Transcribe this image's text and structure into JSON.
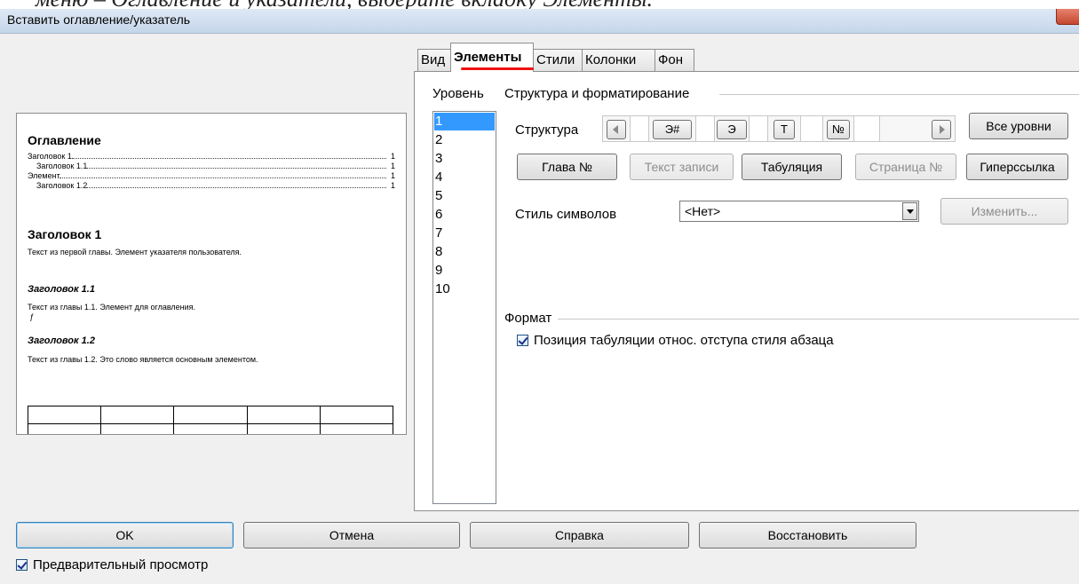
{
  "window": {
    "title": "Вставить оглавление/указатель",
    "top_strip_text": "меню – Оглавление и указатели, выберите вкладку Элементы."
  },
  "preview": {
    "heading": "Оглавление",
    "toc": [
      {
        "text": "Заголовок 1",
        "page": "1",
        "indent": false
      },
      {
        "text": "Заголовок 1.1",
        "page": "1",
        "indent": true
      },
      {
        "text": "Элемент",
        "page": "1",
        "indent": false
      },
      {
        "text": "Заголовок 1.2",
        "page": "1",
        "indent": true
      }
    ],
    "h1": "Заголовок 1",
    "p1": "Текст из первой главы. Элемент указателя пользователя.",
    "h11": "Заголовок 1.1",
    "p11": "Текст из главы 1.1. Элемент для оглавления.",
    "h12": "Заголовок 1.2",
    "p12": "Текст из главы 1.2. Это слово является основным элементом."
  },
  "tabs": [
    "Вид",
    "Элементы",
    "Стили",
    "Колонки",
    "Фон"
  ],
  "level": {
    "label": "Уровень",
    "items": [
      "1",
      "2",
      "3",
      "4",
      "5",
      "6",
      "7",
      "8",
      "9",
      "10"
    ]
  },
  "structure": {
    "group_label": "Структура и форматирование",
    "label": "Структура",
    "tokens": [
      "Э#",
      "Э",
      "Т",
      "№"
    ],
    "all_levels": "Все уровни",
    "buttons": [
      "Глава №",
      "Текст записи",
      "Табуляция",
      "Страница №",
      "Гиперссылка"
    ],
    "char_style_label": "Стиль символов",
    "char_style_value": "<Нет>",
    "edit_button": "Изменить..."
  },
  "format": {
    "group_label": "Формат",
    "tab_position_label": "Позиция табуляции относ. отступа стиля абзаца",
    "tab_position_checked": true
  },
  "footer": {
    "ok": "OK",
    "cancel": "Отмена",
    "help": "Справка",
    "reset": "Восстановить",
    "preview_label": "Предварительный просмотр",
    "preview_checked": true
  }
}
